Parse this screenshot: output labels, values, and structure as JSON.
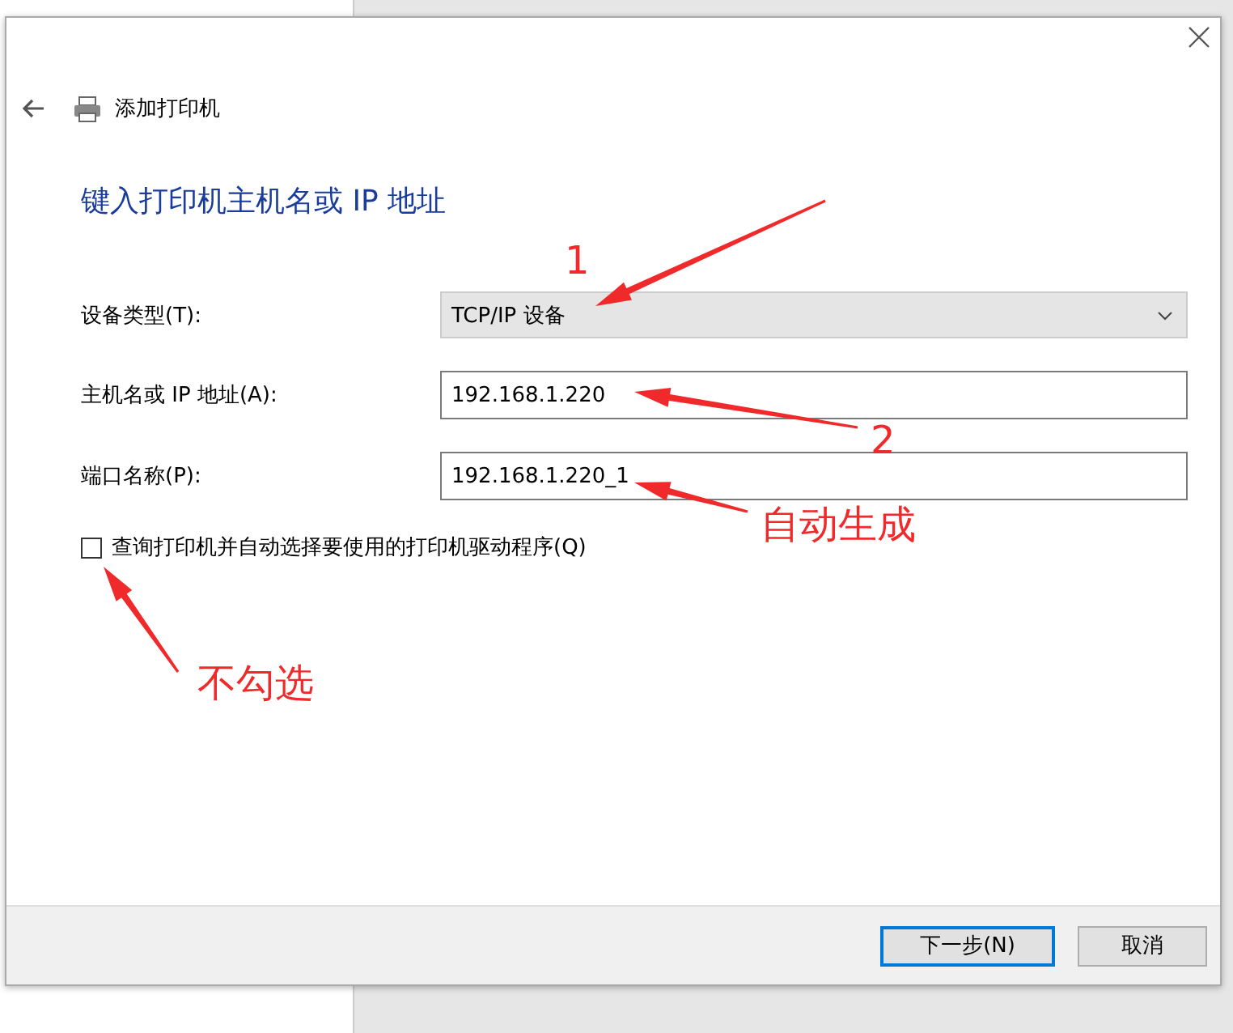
{
  "dialog": {
    "title": "添加打印机",
    "heading": "键入打印机主机名或 IP 地址"
  },
  "fields": [
    {
      "kind": "dropdown",
      "label": "设备类型(T):",
      "value": "TCP/IP 设备"
    },
    {
      "kind": "text",
      "label": "主机名或 IP 地址(A):",
      "value": "192.168.1.220"
    },
    {
      "kind": "text",
      "label": "端口名称(P):",
      "value": "192.168.1.220_1"
    }
  ],
  "checkbox": {
    "label": "查询打印机并自动选择要使用的打印机驱动程序(Q)",
    "checked": false
  },
  "buttons": [
    {
      "label": "下一步(N)",
      "selected": true
    },
    {
      "label": "取消",
      "selected": false
    }
  ],
  "annotations": [
    {
      "text": "1"
    },
    {
      "text": "2"
    },
    {
      "text": "自动生成"
    },
    {
      "text": "不勾选"
    }
  ]
}
